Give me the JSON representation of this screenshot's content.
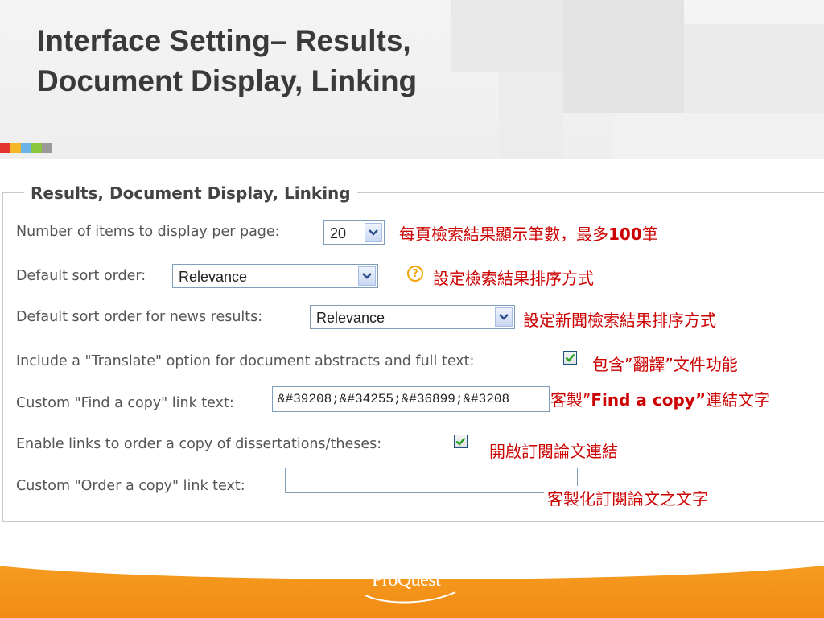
{
  "slide": {
    "title_line1": "Interface Setting– Results,",
    "title_line2": "Document Display, Linking",
    "accent_colors": [
      "#e4322f",
      "#f6b626",
      "#69b3e7",
      "#8cc63f",
      "#999999"
    ]
  },
  "panel": {
    "legend": "Results, Document Display, Linking",
    "items_per_page": {
      "label": "Number of items to display per page:",
      "value": "20",
      "note_prefix": "每頁檢索結果顯示筆數，最多",
      "note_number": "100",
      "note_suffix": "筆"
    },
    "default_sort": {
      "label": "Default sort order:",
      "value": "Relevance",
      "help": "?",
      "note": "設定檢索結果排序方式"
    },
    "news_sort": {
      "label": "Default sort order for news results:",
      "value": "Relevance",
      "note": "設定新聞檢索結果排序方式"
    },
    "translate": {
      "label": "Include a \"Translate\" option for document abstracts and full text:",
      "checked": true,
      "note": "包含”翻譯”文件功能"
    },
    "find_copy": {
      "label": "Custom \"Find a copy\" link text:",
      "value": "&#39208;&#34255;&#36899;&#3208",
      "note_prefix": "客製”",
      "note_bold": "Find a copy”",
      "note_suffix": "連結文字"
    },
    "order_links": {
      "label": "Enable links to order a copy of dissertations/theses:",
      "checked": true,
      "note": "開啟訂閱論文連結"
    },
    "order_text": {
      "label": "Custom \"Order a copy\" link text:",
      "value": "",
      "note": "客製化訂閱論文之文字"
    }
  },
  "footer": {
    "logo": "ProQuest"
  }
}
